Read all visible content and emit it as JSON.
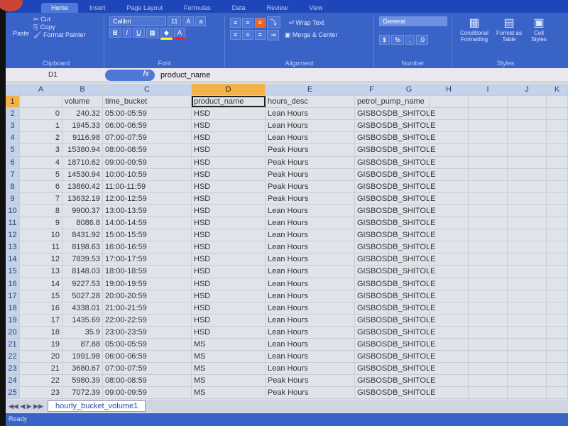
{
  "ribbon": {
    "tabs": [
      "Home",
      "Insert",
      "Page Layout",
      "Formulas",
      "Data",
      "Review",
      "View"
    ],
    "clipboard": {
      "paste": "Paste",
      "cut": "Cut",
      "copy": "Copy",
      "format_painter": "Format Painter",
      "label": "Clipboard"
    },
    "font": {
      "name": "Calibri",
      "size": "11",
      "label": "Font"
    },
    "alignment": {
      "wrap": "Wrap Text",
      "merge": "Merge & Center",
      "label": "Alignment"
    },
    "number": {
      "format": "General",
      "label": "Number"
    },
    "styles": {
      "conditional": "Conditional Formatting",
      "format_table": "Format as Table",
      "cell_styles": "Cell Styles",
      "label": "Styles"
    }
  },
  "formula_bar": {
    "name_box": "D1",
    "fx": "fx",
    "value": "product_name"
  },
  "columns": [
    "A",
    "B",
    "C",
    "D",
    "E",
    "F",
    "G",
    "H",
    "I",
    "J",
    "K"
  ],
  "headers": [
    "",
    "volume",
    "time_bucket",
    "product_name",
    "hours_desc",
    "petrol_pump_name"
  ],
  "rows": [
    [
      "0",
      "240.32",
      "05:00-05:59",
      "HSD",
      "Lean Hours",
      "GISBOSDB_SHITOLE"
    ],
    [
      "1",
      "1945.33",
      "06:00-06:59",
      "HSD",
      "Lean Hours",
      "GISBOSDB_SHITOLE"
    ],
    [
      "2",
      "9116.98",
      "07:00-07:59",
      "HSD",
      "Lean Hours",
      "GISBOSDB_SHITOLE"
    ],
    [
      "3",
      "15380.94",
      "08:00-08:59",
      "HSD",
      "Peak Hours",
      "GISBOSDB_SHITOLE"
    ],
    [
      "4",
      "18710.62",
      "09:00-09:59",
      "HSD",
      "Peak Hours",
      "GISBOSDB_SHITOLE"
    ],
    [
      "5",
      "14530.94",
      "10:00-10:59",
      "HSD",
      "Peak Hours",
      "GISBOSDB_SHITOLE"
    ],
    [
      "6",
      "13860.42",
      "11:00-11:59",
      "HSD",
      "Peak Hours",
      "GISBOSDB_SHITOLE"
    ],
    [
      "7",
      "13632.19",
      "12:00-12:59",
      "HSD",
      "Peak Hours",
      "GISBOSDB_SHITOLE"
    ],
    [
      "8",
      "9900.37",
      "13:00-13:59",
      "HSD",
      "Lean Hours",
      "GISBOSDB_SHITOLE"
    ],
    [
      "9",
      "8086.8",
      "14:00-14:59",
      "HSD",
      "Lean Hours",
      "GISBOSDB_SHITOLE"
    ],
    [
      "10",
      "8431.92",
      "15:00-15:59",
      "HSD",
      "Lean Hours",
      "GISBOSDB_SHITOLE"
    ],
    [
      "11",
      "8198.63",
      "16:00-16:59",
      "HSD",
      "Lean Hours",
      "GISBOSDB_SHITOLE"
    ],
    [
      "12",
      "7839.53",
      "17:00-17:59",
      "HSD",
      "Lean Hours",
      "GISBOSDB_SHITOLE"
    ],
    [
      "13",
      "8148.03",
      "18:00-18:59",
      "HSD",
      "Lean Hours",
      "GISBOSDB_SHITOLE"
    ],
    [
      "14",
      "9227.53",
      "19:00-19:59",
      "HSD",
      "Lean Hours",
      "GISBOSDB_SHITOLE"
    ],
    [
      "15",
      "5027.28",
      "20:00-20:59",
      "HSD",
      "Lean Hours",
      "GISBOSDB_SHITOLE"
    ],
    [
      "16",
      "4338.01",
      "21:00-21:59",
      "HSD",
      "Lean Hours",
      "GISBOSDB_SHITOLE"
    ],
    [
      "17",
      "1435.69",
      "22:00-22:59",
      "HSD",
      "Lean Hours",
      "GISBOSDB_SHITOLE"
    ],
    [
      "18",
      "35.9",
      "23:00-23:59",
      "HSD",
      "Lean Hours",
      "GISBOSDB_SHITOLE"
    ],
    [
      "19",
      "87.88",
      "05:00-05:59",
      "MS",
      "Lean Hours",
      "GISBOSDB_SHITOLE"
    ],
    [
      "20",
      "1991.98",
      "06:00-06:59",
      "MS",
      "Lean Hours",
      "GISBOSDB_SHITOLE"
    ],
    [
      "21",
      "3680.67",
      "07:00-07:59",
      "MS",
      "Lean Hours",
      "GISBOSDB_SHITOLE"
    ],
    [
      "22",
      "5980.39",
      "08:00-08:59",
      "MS",
      "Peak Hours",
      "GISBOSDB_SHITOLE"
    ],
    [
      "23",
      "7072.39",
      "09:00-09:59",
      "MS",
      "Peak Hours",
      "GISBOSDB_SHITOLE"
    ]
  ],
  "sheet_tab": "hourly_bucket_volume1",
  "status": "Ready"
}
